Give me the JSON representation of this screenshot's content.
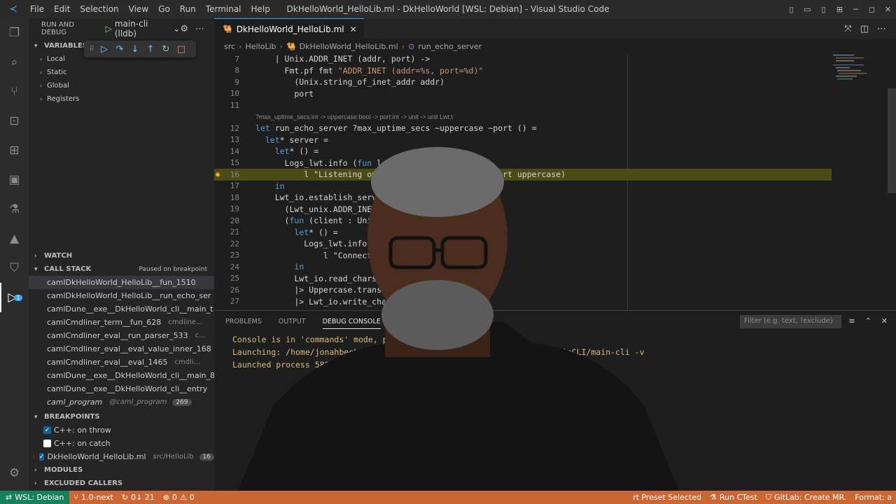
{
  "window": {
    "title": "DkHelloWorld_HelloLib.ml - DkHelloWorld [WSL: Debian] - Visual Studio Code",
    "menu": [
      "File",
      "Edit",
      "Selection",
      "View",
      "Go",
      "Run",
      "Terminal",
      "Help"
    ]
  },
  "activity_bar": {
    "items": [
      "explorer-icon",
      "search-icon",
      "source-control-icon",
      "remote-explorer-icon",
      "extensions-icon",
      "image-icon",
      "testing-icon",
      "ocaml-icon",
      "gitlab-icon",
      "run-debug-icon"
    ],
    "active": "run-debug-icon",
    "debug_badge": "1",
    "bottom": [
      "accounts-icon",
      "settings-gear-icon"
    ]
  },
  "sidebar": {
    "header": "RUN AND DEBUG",
    "config": "main-cli (lldb)",
    "variables": {
      "title": "VARIABLES",
      "items": [
        "Local",
        "Static",
        "Global",
        "Registers"
      ]
    },
    "watch": {
      "title": "WATCH"
    },
    "call_stack": {
      "title": "CALL STACK",
      "status": "Paused on breakpoint",
      "frames": [
        {
          "name": "camlDkHelloWorld_HelloLib__fun_1510",
          "src": "",
          "badge": ""
        },
        {
          "name": "camlDkHelloWorld_HelloLib__run_echo_ser",
          "src": "",
          "badge": ""
        },
        {
          "name": "camlDune__exe__DkHelloWorld_cli__main_t",
          "src": "",
          "badge": ""
        },
        {
          "name": "camlCmdliner_term__fun_628",
          "src": "cmdline...",
          "badge": ""
        },
        {
          "name": "camlCmdliner_eval__run_parser_533",
          "src": "c...",
          "badge": ""
        },
        {
          "name": "camlCmdliner_eval__eval_value_inner_168",
          "src": "",
          "badge": ""
        },
        {
          "name": "camlCmdliner_eval__eval_1465",
          "src": "cmdli...",
          "badge": ""
        },
        {
          "name": "camlDune__exe__DkHelloWorld_cli__main_8",
          "src": "",
          "badge": ""
        },
        {
          "name": "camlDune__exe__DkHelloWorld_cli__entry",
          "src": "",
          "badge": ""
        },
        {
          "name": "caml_program",
          "src": "@caml_program",
          "badge": "269"
        }
      ]
    },
    "breakpoints": {
      "title": "BREAKPOINTS",
      "items": [
        {
          "label": "C++: on throw",
          "checked": true,
          "src": "",
          "badge": ""
        },
        {
          "label": "C++: on catch",
          "checked": false,
          "src": "",
          "badge": ""
        },
        {
          "label": "DkHelloWorld_HelloLib.ml",
          "checked": true,
          "src": "src/HelloLib",
          "badge": "16"
        }
      ]
    },
    "modules": {
      "title": "MODULES"
    },
    "excluded": {
      "title": "EXCLUDED CALLERS"
    }
  },
  "editor": {
    "tab": "DkHelloWorld_HelloLib.ml",
    "breadcrumb": [
      "src",
      "HelloLib",
      "DkHelloWorld_HelloLib.ml",
      "run_echo_server"
    ],
    "hint": "?max_uptime_secs:int -> uppercase:bool -> port:int -> unit -> unit Lwt.t",
    "lines": [
      {
        "n": "7",
        "t": "    | Unix.ADDR_INET (addr, port) ->"
      },
      {
        "n": "8",
        "t": "      Fmt.pf fmt \"ADDR_INET (addr=%s, port=%d)\""
      },
      {
        "n": "9",
        "t": "        (Unix.string_of_inet_addr addr)"
      },
      {
        "n": "10",
        "t": "        port"
      },
      {
        "n": "11",
        "t": ""
      },
      {
        "n": "12",
        "t": "let run_echo_server ?max_uptime_secs ~uppercase ~port () ="
      },
      {
        "n": "13",
        "t": "  let* server ="
      },
      {
        "n": "14",
        "t": "    let* () ="
      },
      {
        "n": "15",
        "t": "      Logs_lwt.info (fun l ->"
      },
      {
        "n": "16",
        "t": "          l \"Listening on port %d                 ort uppercase)"
      },
      {
        "n": "17",
        "t": "    in"
      },
      {
        "n": "18",
        "t": "    Lwt_io.establish_server_wi"
      },
      {
        "n": "19",
        "t": "      (Lwt_unix.ADDR_INET (Un"
      },
      {
        "n": "20",
        "t": "      (fun (client : Unix.so"
      },
      {
        "n": "21",
        "t": "        let* () ="
      },
      {
        "n": "22",
        "t": "          Logs_lwt.info (f"
      },
      {
        "n": "23",
        "t": "              l \"Connected                     ent)"
      },
      {
        "n": "24",
        "t": "        in"
      },
      {
        "n": "25",
        "t": "        Lwt_io.read_chars r"
      },
      {
        "n": "26",
        "t": "        |> Uppercase.transf"
      },
      {
        "n": "27",
        "t": "        |> Lwt_io.write_char"
      },
      {
        "n": "28",
        "t": "  in"
      }
    ]
  },
  "panel": {
    "tabs": [
      "PROBLEMS",
      "OUTPUT",
      "DEBUG CONSOLE",
      "TERM"
    ],
    "active_tab": "DEBUG CONSOLE",
    "filter_placeholder": "Filter (e.g. text, !exclude)",
    "console": [
      "Console is in 'commands' mode, pr",
      "Launching: /home/jonahbeckf                                    rc/MainCLI/main-cli -v",
      "Launched process 5886"
    ]
  },
  "statusbar": {
    "remote": "WSL: Debian",
    "branch": "1.0-next",
    "sync": "0↓ 21",
    "problems": "0",
    "warnings": "0",
    "right": [
      "rt Preset Selected",
      "Run CTest",
      "GitLab: Create MR.",
      "Format: a"
    ]
  }
}
